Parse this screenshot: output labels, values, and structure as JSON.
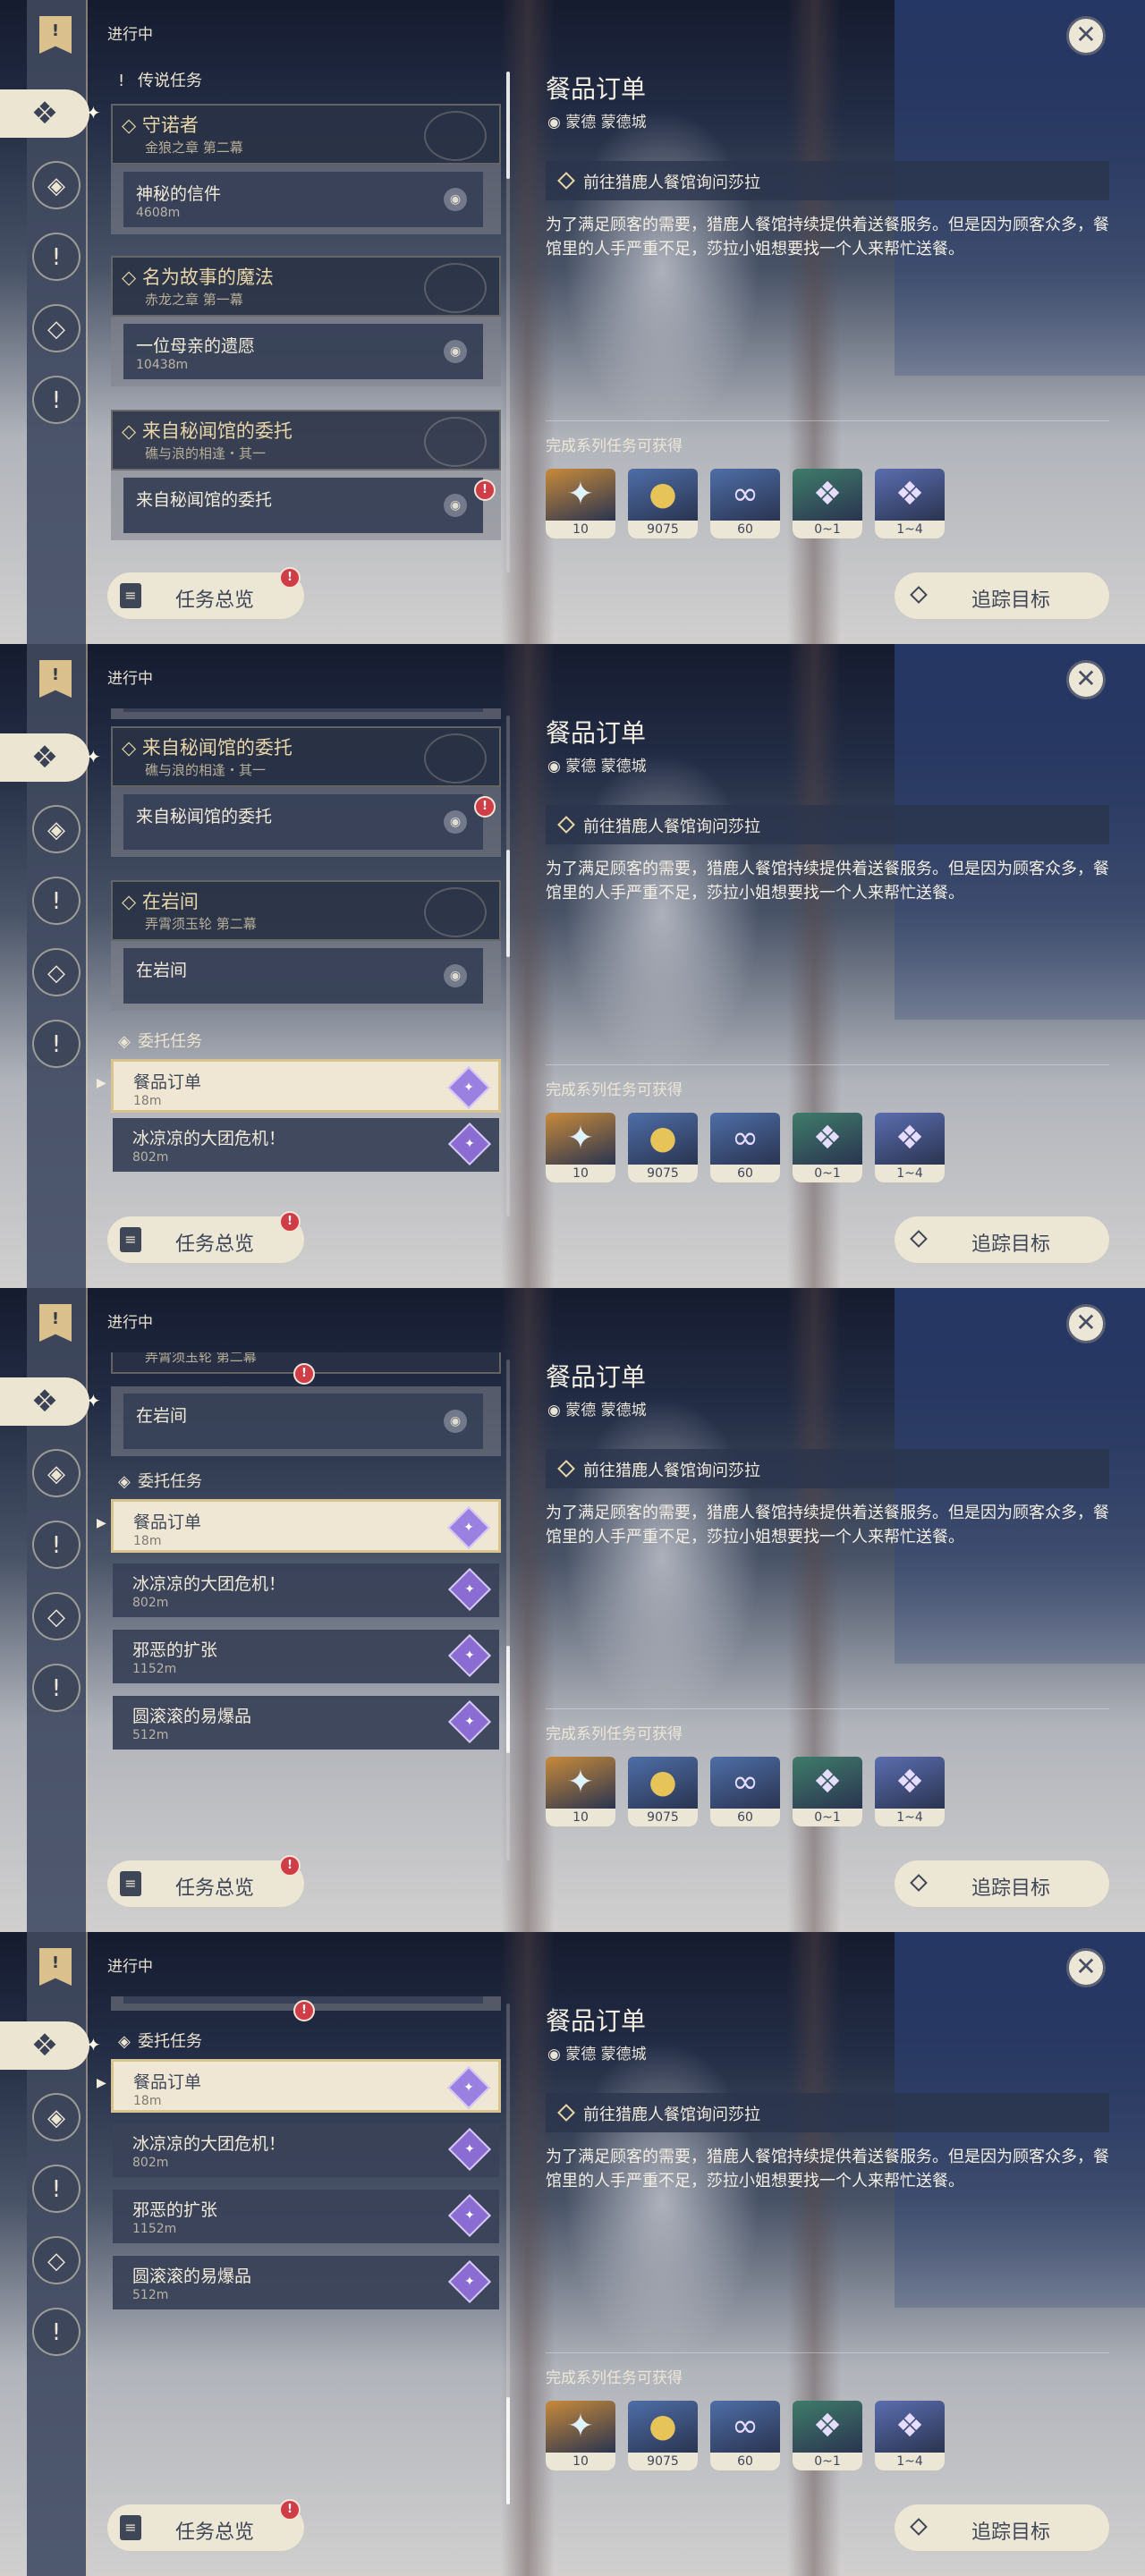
{
  "common": {
    "section_title": "进行中",
    "bookmark_glyph": "!",
    "close_glyph": "✕",
    "overview_label": "任务总览",
    "track_label": "追踪目标",
    "detail": {
      "title": "餐品订单",
      "location": "蒙德 蒙德城",
      "objective": "前往猎鹿人餐馆询问莎拉",
      "description": "为了满足顾客的需要，猎鹿人餐馆持续提供着送餐服务。但是因为顾客众多，餐馆里的人手严重不足，莎拉小姐想要找一个人来帮忙送餐。",
      "rewards_label": "完成系列任务可获得",
      "rewards": [
        {
          "icon": "primogem-icon",
          "glyph": "✦",
          "count": "10",
          "color": "#c88a3a"
        },
        {
          "icon": "mora-icon",
          "glyph": "●",
          "count": "9075",
          "color": "#4e6ea8"
        },
        {
          "icon": "companionship-exp-icon",
          "glyph": "∞",
          "count": "60",
          "color": "#4e6ea8"
        },
        {
          "icon": "crystal-chunk-icon",
          "glyph": "❖",
          "count": "0~1",
          "color": "#3f7c6a"
        },
        {
          "icon": "crystal-cluster-icon",
          "glyph": "❖",
          "count": "1~4",
          "color": "#5b6db0"
        }
      ]
    }
  },
  "labels": {
    "legend_header": "传说任务",
    "commission_header": "委托任务",
    "ch1_title": "守诺者",
    "ch1_sub": "金狼之章 第二幕",
    "ch1_quest": "神秘的信件",
    "ch1_dist": "4608m",
    "ch2_title": "名为故事的魔法",
    "ch2_sub": "赤龙之章 第一幕",
    "ch2_quest": "一位母亲的遗愿",
    "ch2_dist": "10438m",
    "ch3_title": "来自秘闻馆的委托",
    "ch3_sub": "礁与浪的相逢・其一",
    "ch3_quest": "来自秘闻馆的委托",
    "ch4_title": "在岩间",
    "ch4_sub": "弄霄须玉轮 第二幕",
    "ch4_quest": "在岩间",
    "c1_title": "餐品订单",
    "c1_dist": "18m",
    "c2_title": "冰凉凉的大团危机！",
    "c2_dist": "802m",
    "c3_title": "邪恶的扩张",
    "c3_dist": "1152m",
    "c4_title": "圆滚滚的易爆品",
    "c4_dist": "512m"
  },
  "icons": {
    "legend_header": "!",
    "commission_header": "◈",
    "chapter": "◇",
    "pin": "◉",
    "alert": "!",
    "nav": [
      "❖",
      "◈",
      "!",
      "◇",
      "!"
    ],
    "arrow": "▶",
    "star": "✦",
    "overview": "≡"
  }
}
